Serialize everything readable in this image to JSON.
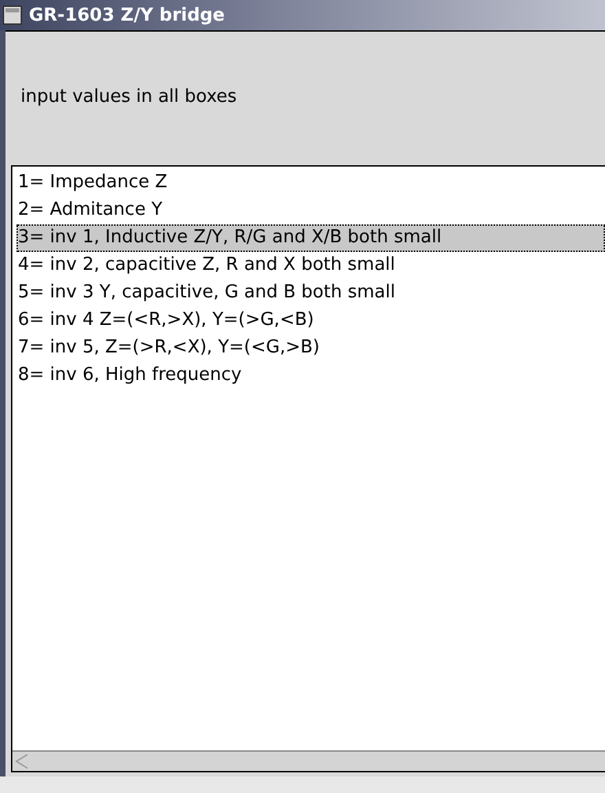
{
  "window": {
    "title": "GR-1603 Z/Y bridge"
  },
  "prompt": "input values in all boxes",
  "list": {
    "items": [
      {
        "label": "1= Impedance Z",
        "selected": false
      },
      {
        "label": "2= Admitance Y",
        "selected": false
      },
      {
        "label": "3= inv 1, Inductive Z/Y, R/G and X/B both small",
        "selected": true
      },
      {
        "label": "4= inv 2, capacitive Z, R and X both small",
        "selected": false
      },
      {
        "label": "5= inv 3 Y, capacitive, G and B both small",
        "selected": false
      },
      {
        "label": "6= inv 4 Z=(<R,>X), Y=(>G,<B)",
        "selected": false
      },
      {
        "label": "7= inv 5, Z=(>R,<X), Y=(<G,>B)",
        "selected": false
      },
      {
        "label": "8= inv 6, High frequency",
        "selected": false
      }
    ]
  }
}
